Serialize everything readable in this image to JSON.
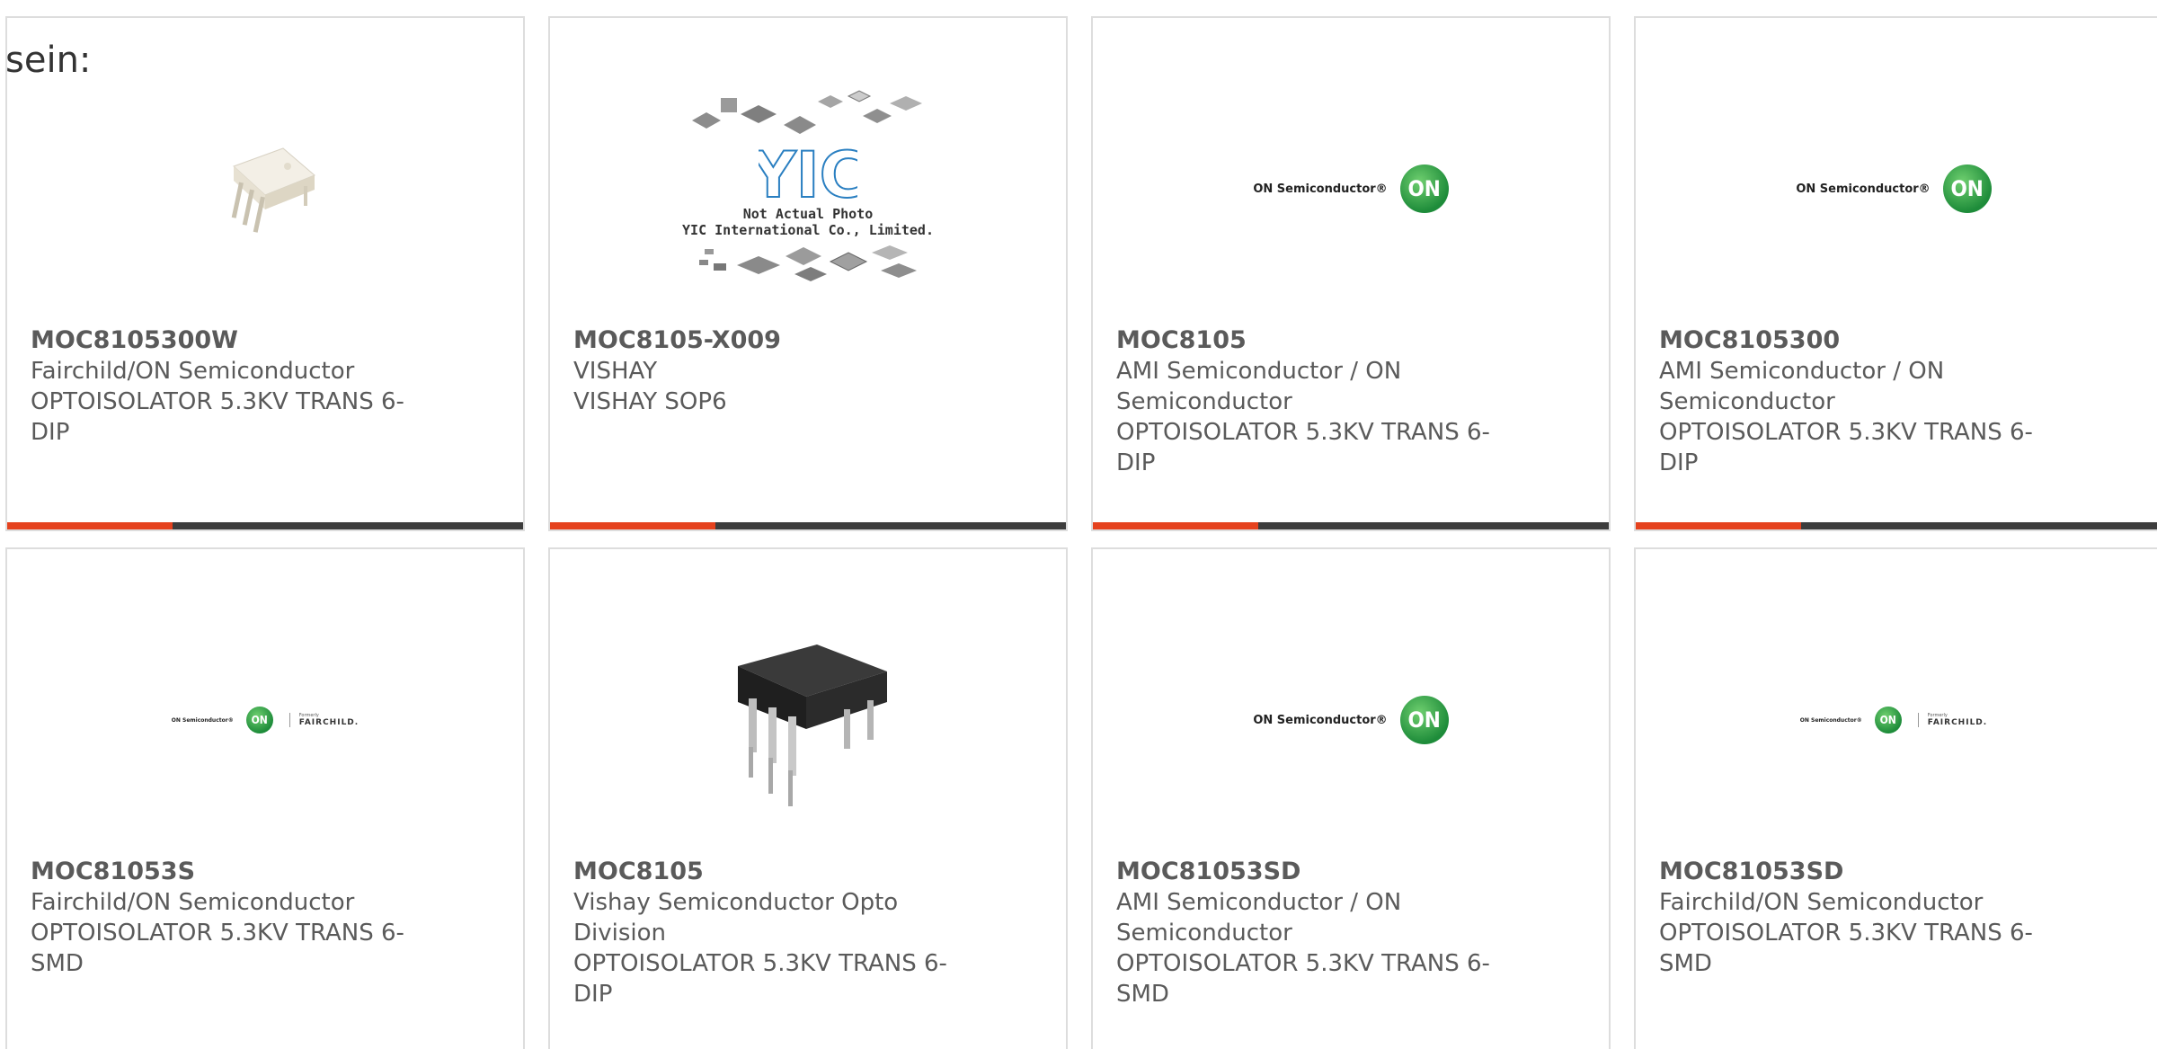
{
  "intro_text": "sein:",
  "accent_color": "#e5421e",
  "bar_color": "#3d3d3d",
  "cards": [
    {
      "part": "MOC8105300W",
      "maker": "Fairchild/ON Semiconductor",
      "desc": "OPTOISOLATOR 5.3KV TRANS 6-DIP",
      "image": "ic-dip6-white-photo"
    },
    {
      "part": "MOC8105-X009",
      "maker": "VISHAY",
      "desc": "VISHAY SOP6",
      "image": "yic-placeholder",
      "image_text_1": "Not Actual Photo",
      "image_text_2": "YIC International Co., Limited."
    },
    {
      "part": "MOC8105",
      "maker": "AMI Semiconductor / ON Semiconductor",
      "desc": "OPTOISOLATOR 5.3KV TRANS 6-DIP",
      "image": "on-semiconductor-logo"
    },
    {
      "part": "MOC8105300",
      "maker": "AMI Semiconductor / ON Semiconductor",
      "desc": "OPTOISOLATOR 5.3KV TRANS 6-DIP",
      "image": "on-semiconductor-logo"
    },
    {
      "part": "MOC81053S",
      "maker": "Fairchild/ON Semiconductor",
      "desc": "OPTOISOLATOR 5.3KV TRANS 6-SMD",
      "image": "on-fairchild-logo"
    },
    {
      "part": "MOC8105",
      "maker": "Vishay Semiconductor Opto Division",
      "desc": "OPTOISOLATOR 5.3KV TRANS 6-DIP",
      "image": "ic-dip6-black-photo"
    },
    {
      "part": "MOC81053SD",
      "maker": "AMI Semiconductor / ON Semiconductor",
      "desc": "OPTOISOLATOR 5.3KV TRANS 6-SMD",
      "image": "on-semiconductor-logo"
    },
    {
      "part": "MOC81053SD",
      "maker": "Fairchild/ON Semiconductor",
      "desc": "OPTOISOLATOR 5.3KV TRANS 6-SMD",
      "image": "on-fairchild-logo"
    }
  ],
  "logo_text": {
    "on_semi": "ON Semiconductor®",
    "on_mark": "ON",
    "fair_formerly": "Formerly",
    "fair_name": "FAIRCHILD."
  }
}
